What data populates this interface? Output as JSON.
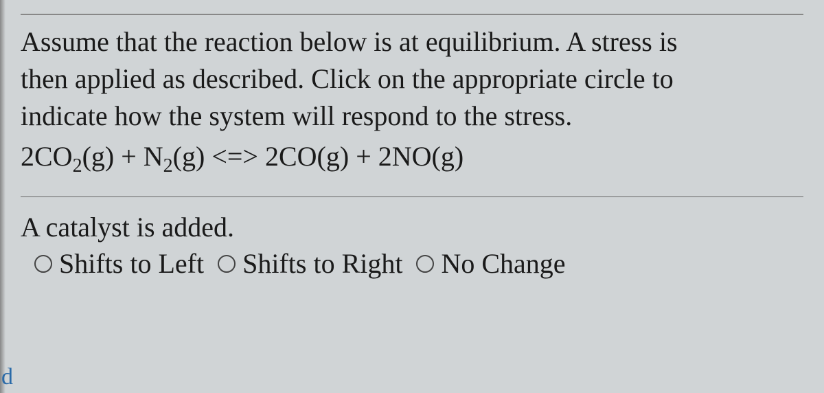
{
  "question": {
    "line1": "Assume that the reaction below is at equilibrium. A stress is",
    "line2": "then applied as described. Click on the appropriate circle to",
    "line3": "indicate how the system will respond to the stress.",
    "equation_parts": {
      "r1_coef": "2CO",
      "r1_sub": "2",
      "r1_state": "(g) + N",
      "r2_sub": "2",
      "r2_state": "(g) <=> 2CO(g) + 2NO(g)"
    }
  },
  "stress": {
    "description": "A catalyst is added.",
    "options": [
      "Shifts to Left",
      "Shifts to Right",
      "No Change"
    ]
  },
  "fragment": "d"
}
